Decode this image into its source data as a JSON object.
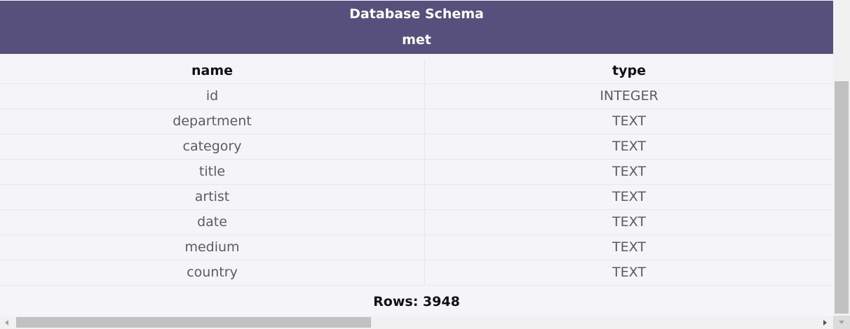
{
  "header": {
    "title": "Database Schema",
    "table_name": "met"
  },
  "table": {
    "columns": [
      "name",
      "type"
    ],
    "rows": [
      {
        "name": "id",
        "type": "INTEGER"
      },
      {
        "name": "department",
        "type": "TEXT"
      },
      {
        "name": "category",
        "type": "TEXT"
      },
      {
        "name": "title",
        "type": "TEXT"
      },
      {
        "name": "artist",
        "type": "TEXT"
      },
      {
        "name": "date",
        "type": "TEXT"
      },
      {
        "name": "medium",
        "type": "TEXT"
      },
      {
        "name": "country",
        "type": "TEXT"
      }
    ]
  },
  "footer": {
    "rows_count": "Rows: 3948"
  },
  "colors": {
    "header_bg": "#57507c",
    "page_bg": "#f5f4f9",
    "scroll_thumb": "#c1c1c1"
  }
}
